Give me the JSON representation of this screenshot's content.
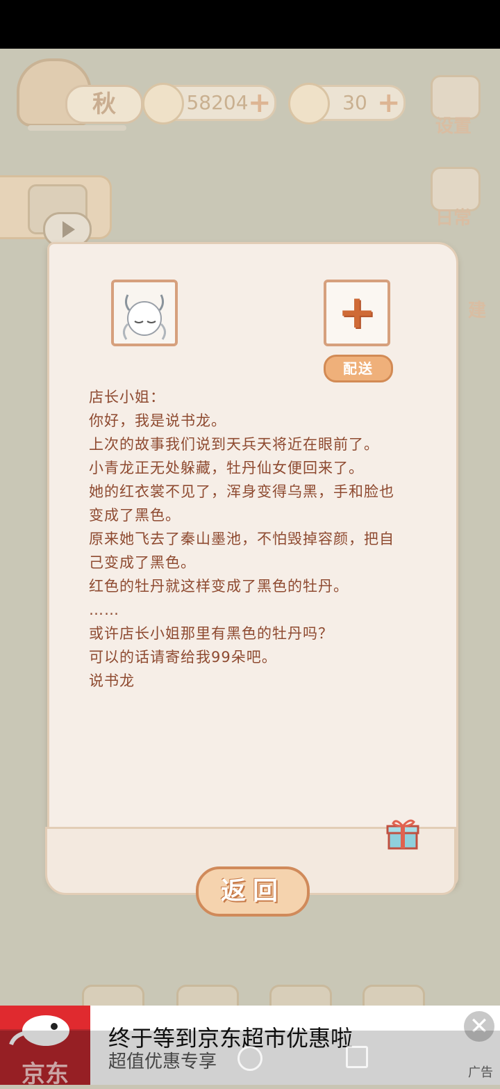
{
  "hud": {
    "season_label": "秋",
    "fish_coins": "58204",
    "cheese": "30",
    "plus_symbol": "+",
    "settings_label": "设置",
    "daily_label": "日常",
    "build_label": "建"
  },
  "letter": {
    "deliver_label": "配送",
    "add_symbol": "+",
    "lines": [
      "店长小姐：",
      "你好，我是说书龙。",
      "上次的故事我们说到天兵天将近在眼前了。",
      "小青龙正无处躲藏，牡丹仙女便回来了。",
      "她的红衣裳不见了，浑身变得乌黑，手和脸也",
      "变成了黑色。",
      "原来她飞去了秦山墨池，不怕毁掉容颜，把自",
      "己变成了黑色。",
      "红色的牡丹就这样变成了黑色的牡丹。",
      "……",
      "或许店长小姐那里有黑色的牡丹吗？",
      "可以的话请寄给我99朵吧。",
      "说书龙"
    ],
    "back_label": "返回"
  },
  "ad": {
    "brand": "京东",
    "headline": "终于等到京东超市优惠啦",
    "subline": "超值优惠专享",
    "label": "广告",
    "close_symbol": "✕"
  },
  "colors": {
    "letter_text": "#8e4a30",
    "button_fill": "#efb07a",
    "ad_red": "#e02a2f"
  }
}
